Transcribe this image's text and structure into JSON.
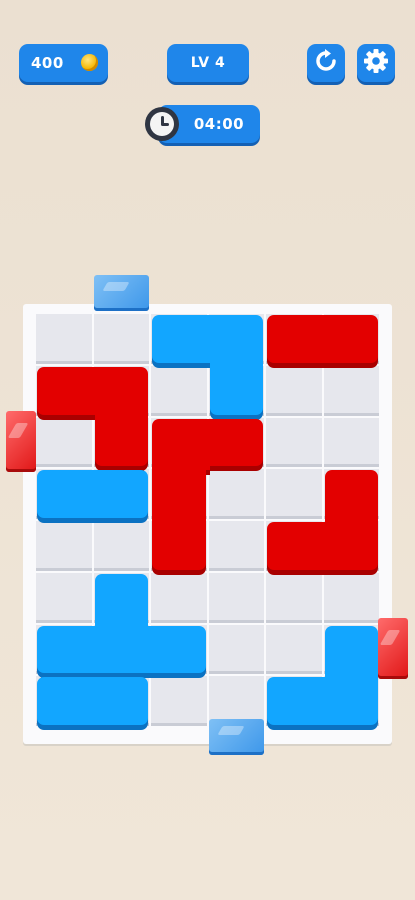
{
  "hud": {
    "coins": "400",
    "level": "LV 4",
    "timer": "04:00"
  },
  "icons": {
    "coin": "coin-icon",
    "restart": "restart-icon",
    "settings": "gear-icon",
    "clock": "clock-icon"
  },
  "colors": {
    "red_piece": "#e30000",
    "blue_piece": "#12a6ff",
    "hud_blue": "#1f86ea",
    "background": "#ece2d4"
  },
  "board": {
    "columns": 6,
    "rows": 8,
    "pieces": [
      {
        "name": "blue-piece-top-l",
        "color": "blue",
        "cells": [
          [
            2,
            0
          ],
          [
            3,
            0
          ],
          [
            3,
            1
          ]
        ]
      },
      {
        "name": "red-piece-top-bar",
        "color": "red",
        "cells": [
          [
            4,
            0
          ],
          [
            5,
            0
          ]
        ]
      },
      {
        "name": "red-piece-left-l",
        "color": "red",
        "cells": [
          [
            0,
            1
          ],
          [
            1,
            1
          ],
          [
            1,
            2
          ]
        ]
      },
      {
        "name": "red-piece-center-l",
        "color": "red",
        "cells": [
          [
            2,
            2
          ],
          [
            3,
            2
          ],
          [
            2,
            3
          ],
          [
            2,
            4
          ]
        ]
      },
      {
        "name": "blue-piece-left-bar",
        "color": "blue",
        "cells": [
          [
            0,
            3
          ],
          [
            1,
            3
          ]
        ]
      },
      {
        "name": "red-piece-right-l",
        "color": "red",
        "cells": [
          [
            5,
            3
          ],
          [
            4,
            4
          ],
          [
            5,
            4
          ]
        ]
      },
      {
        "name": "blue-piece-t",
        "color": "blue",
        "cells": [
          [
            1,
            5
          ],
          [
            0,
            6
          ],
          [
            1,
            6
          ],
          [
            2,
            6
          ]
        ]
      },
      {
        "name": "blue-piece-bottom-bar",
        "color": "blue",
        "cells": [
          [
            0,
            7
          ],
          [
            1,
            7
          ]
        ]
      },
      {
        "name": "blue-piece-right-l",
        "color": "blue",
        "cells": [
          [
            5,
            6
          ],
          [
            4,
            7
          ],
          [
            5,
            7
          ]
        ]
      }
    ],
    "gates": [
      {
        "name": "blue-gate-top",
        "color": "blue",
        "side": "top",
        "index": 1
      },
      {
        "name": "red-gate-left",
        "color": "red",
        "side": "left",
        "index": 2
      },
      {
        "name": "red-gate-right",
        "color": "red",
        "side": "right",
        "index": 6
      },
      {
        "name": "blue-gate-bottom",
        "color": "blue",
        "side": "bottom",
        "index": 3
      }
    ]
  }
}
